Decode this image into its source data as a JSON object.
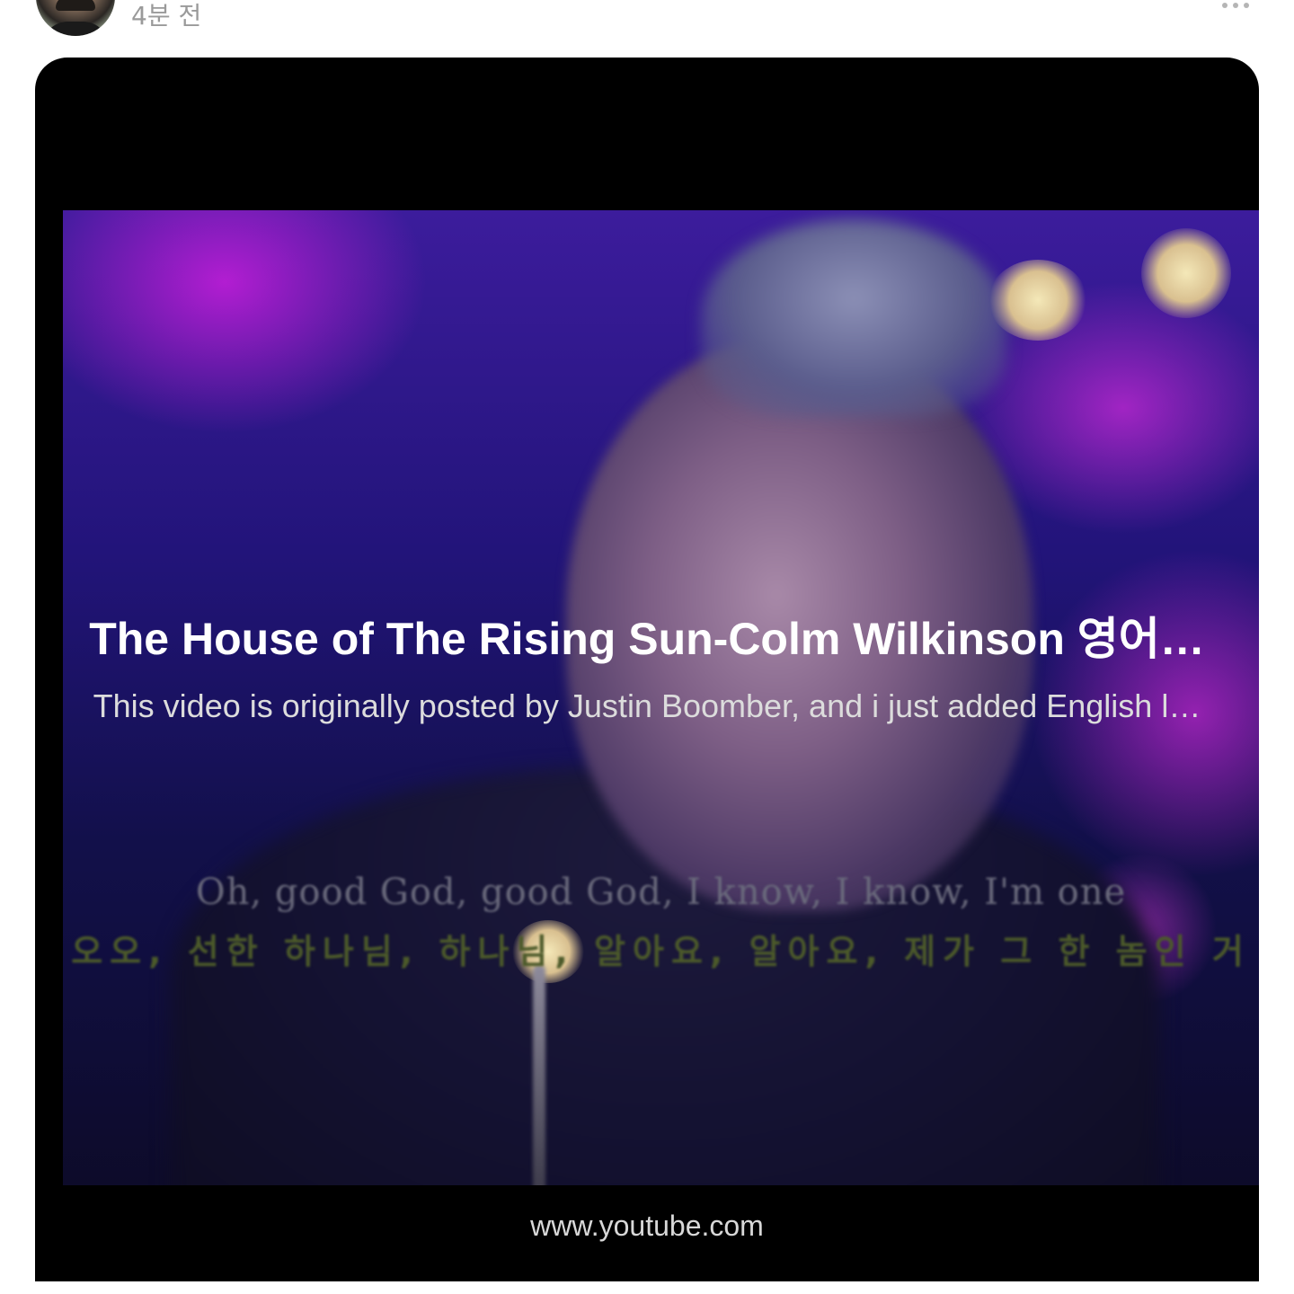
{
  "post": {
    "timestamp": "4분 전"
  },
  "link_card": {
    "title": "The House of The Rising Sun-Colm Wilkinson 영어…",
    "description": "This video is originally posted by Justin Boomber, and i just added English l…",
    "domain": "www.youtube.com",
    "thumbnail": {
      "subtitle_en": "Oh, good God, good God, I know, I know, I'm one",
      "subtitle_ko": "오오, 선한 하나님, 하나님, 알아요, 알아요, 제가 그 한 놈인 거"
    }
  }
}
